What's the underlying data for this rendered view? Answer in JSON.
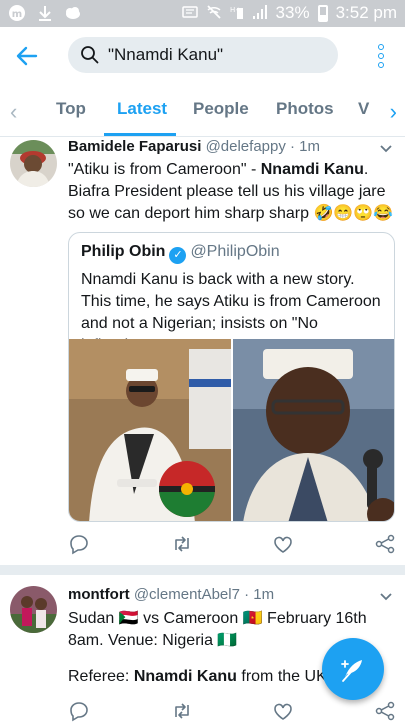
{
  "status_bar": {
    "battery": "33%",
    "time": "3:52 pm",
    "left_icons": [
      "app-icon",
      "download-icon",
      "cloud-icon"
    ],
    "right_icons": [
      "mute-icon",
      "wifi-off-icon",
      "sim-icon",
      "signal-icon",
      "battery-icon"
    ]
  },
  "search": {
    "query": "\"Nnamdi Kanu\""
  },
  "tabs": {
    "items": [
      "Top",
      "Latest",
      "People",
      "Photos",
      "V"
    ],
    "active": "Latest"
  },
  "colors": {
    "accent": "#1da1f2",
    "muted": "#657786",
    "divider": "#e6ecf0"
  },
  "tweets": [
    {
      "name": "Bamidele Faparusi",
      "handle": "@delefappy",
      "time": "· 1m",
      "body_part1": "\"Atiku is from Cameroon\" - ",
      "body_bold": "Nnamdi Kanu",
      "body_part2": ".",
      "body_line2": "Biafra President please tell us his village jare",
      "body_line3": "so we can deport him sharp sharp 🤣😁🙄😂",
      "quote": {
        "name": "Philip Obin",
        "handle": "@PhilipObin",
        "body": "Nnamdi Kanu is back with a new story. This time, he says Atiku is from Cameroon and not a Nigerian; insists on \"No leflendum, n..."
      }
    },
    {
      "name": "montfort",
      "handle": "@clementAbel7",
      "time": "· 1m",
      "line1": "Sudan 🇸🇩 vs Cameroon 🇨🇲 February 16th",
      "line2": "8am. Venue: Nigeria 🇳🇬",
      "line3_prefix": "Referee: ",
      "line3_bold": "Nnamdi Kanu",
      "line3_suffix": " from the UK"
    }
  ]
}
